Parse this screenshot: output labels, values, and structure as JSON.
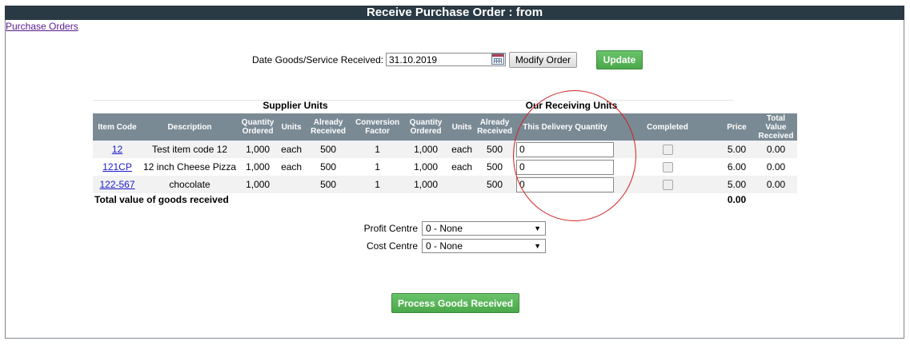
{
  "header": {
    "title": "Receive Purchase Order : from"
  },
  "nav": {
    "back_link": "Purchase Orders"
  },
  "date_row": {
    "label": "Date Goods/Service Received:",
    "value": "31.10.2019",
    "modify_label": "Modify Order",
    "update_label": "Update"
  },
  "groups": {
    "supplier": "Supplier Units",
    "receiving": "Our Receiving Units"
  },
  "columns": {
    "item_code": "Item Code",
    "description": "Description",
    "qty_ordered": "Quantity Ordered",
    "units": "Units",
    "already_received": "Already Received",
    "conversion_factor": "Conversion Factor",
    "qty_ordered2": "Quantity Ordered",
    "units2": "Units",
    "already_received2": "Already Received",
    "this_delivery": "This Delivery Quantity",
    "completed": "Completed",
    "price": "Price",
    "total_value": "Total Value Received"
  },
  "rows": [
    {
      "code": "12",
      "description": "Test item code 12",
      "qty": "1,000",
      "units": "each",
      "received": "500",
      "factor": "1",
      "qty2": "1,000",
      "units2": "each",
      "received2": "500",
      "delivery": "0",
      "price": "5.00",
      "total": "0.00"
    },
    {
      "code": "121CP",
      "description": "12 inch Cheese Pizza",
      "qty": "1,000",
      "units": "each",
      "received": "500",
      "factor": "1",
      "qty2": "1,000",
      "units2": "each",
      "received2": "500",
      "delivery": "0",
      "price": "6.00",
      "total": "0.00"
    },
    {
      "code": "122-567",
      "description": "chocolate",
      "qty": "1,000",
      "units": "",
      "received": "500",
      "factor": "1",
      "qty2": "1,000",
      "units2": "",
      "received2": "500",
      "delivery": "0",
      "price": "5.00",
      "total": "0.00"
    }
  ],
  "totals": {
    "label": "Total value of goods received",
    "value": "0.00"
  },
  "profit_centre": {
    "label": "Profit Centre",
    "value": "0 - None"
  },
  "cost_centre": {
    "label": "Cost Centre",
    "value": "0 - None"
  },
  "actions": {
    "process_label": "Process Goods Received"
  },
  "colors": {
    "title_bar": "#2a3a44",
    "table_header": "#7a8a94",
    "green_button": "#4aa84a",
    "annotation": "#d02020"
  }
}
